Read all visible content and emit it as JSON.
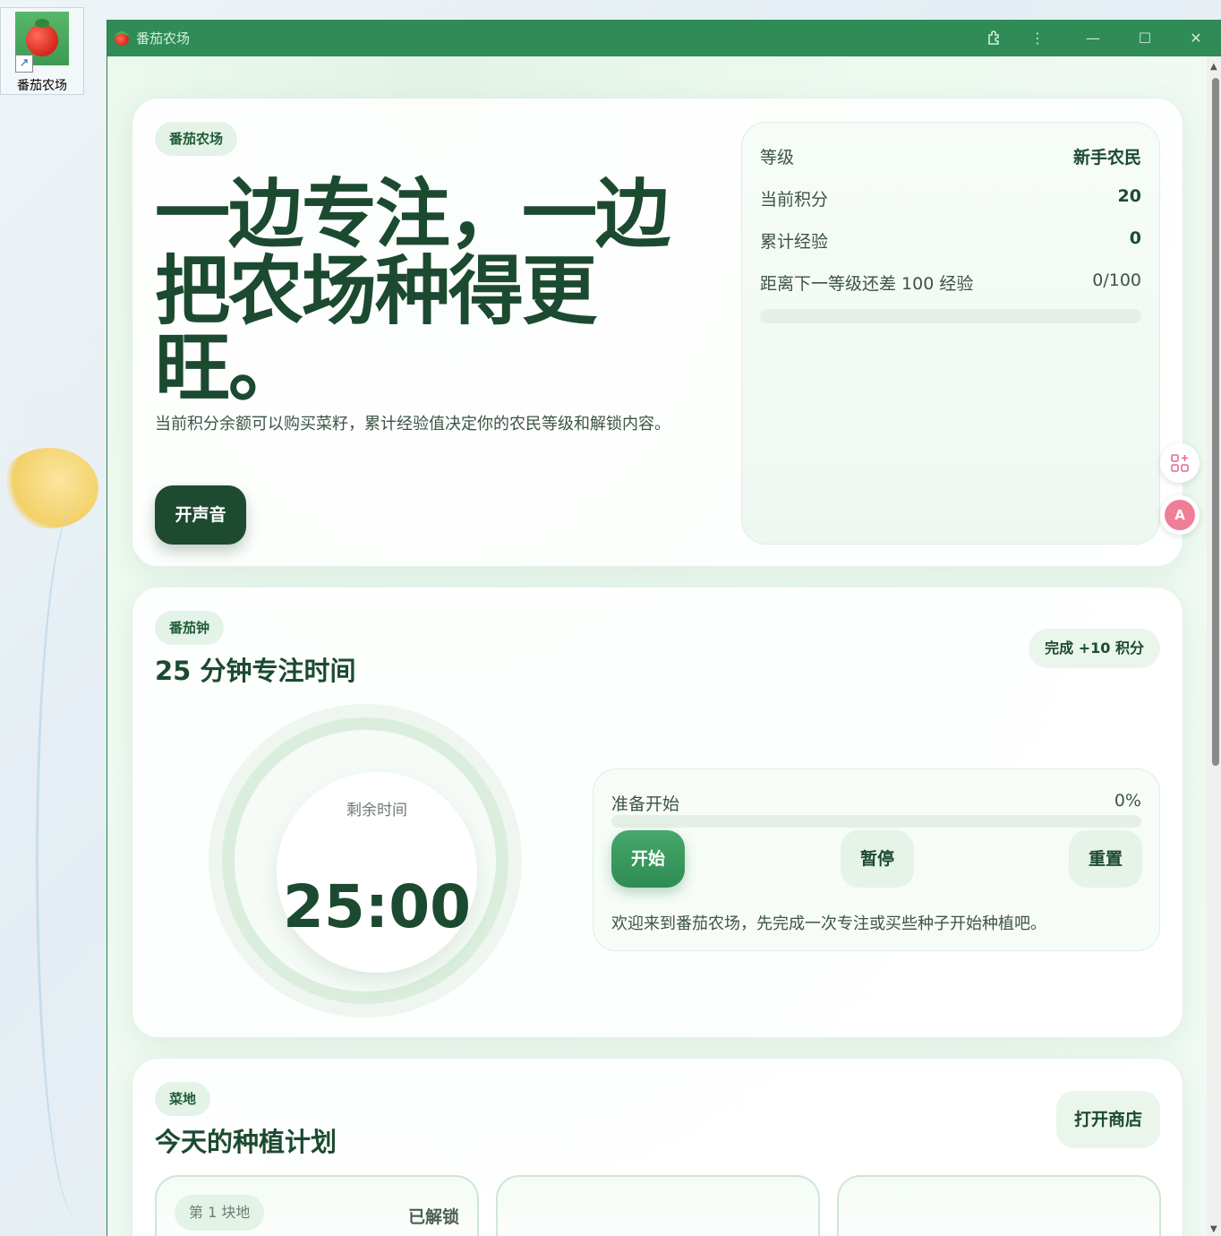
{
  "desktop": {
    "shortcut_label": "番茄农场"
  },
  "window": {
    "title": "番茄农场"
  },
  "hero": {
    "chip": "番茄农场",
    "title": "一边专注，一边把农场种得更旺。",
    "subtitle": "当前积分余额可以购买菜籽，累计经验值决定你的农民等级和解锁内容。",
    "sound_button": "开声音"
  },
  "stats": {
    "level_label": "等级",
    "level_value": "新手农民",
    "points_label": "当前积分",
    "points_value": "20",
    "exp_label": "累计经验",
    "exp_value": "0",
    "next_label": "距离下一等级还差 100 经验",
    "next_value": "0/100",
    "exp_progress": 0
  },
  "pomodoro": {
    "chip": "番茄钟",
    "title": "25 分钟专注时间",
    "reward": "完成 +10 积分",
    "remaining_label": "剩余时间",
    "time": "25:00",
    "status": "准备开始",
    "percent": "0%",
    "progress": 0,
    "start": "开始",
    "pause": "暂停",
    "reset": "重置",
    "message": "欢迎来到番茄农场，先完成一次专注或买些种子开始种植吧。"
  },
  "garden": {
    "chip": "菜地",
    "title": "今天的种植计划",
    "shop_button": "打开商店",
    "plots": [
      {
        "name": "第 1 块地",
        "status": "已解锁"
      },
      {
        "name": "",
        "status": ""
      },
      {
        "name": "",
        "status": ""
      }
    ]
  }
}
